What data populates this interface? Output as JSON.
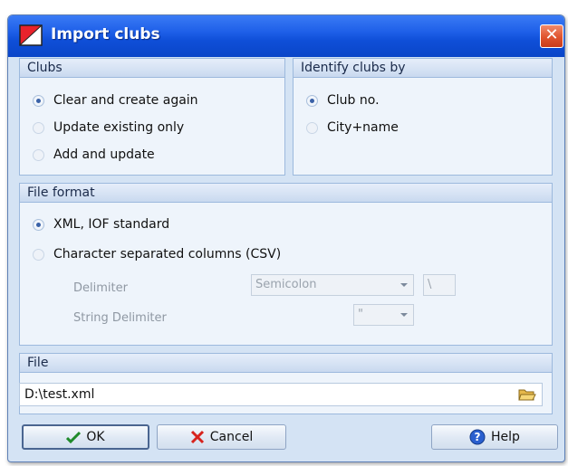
{
  "window": {
    "title": "Import clubs",
    "close_label": "✕"
  },
  "clubs_group": {
    "header": "Clubs",
    "options": [
      {
        "label": "Clear and create again",
        "checked": true
      },
      {
        "label": "Update existing only",
        "checked": false
      },
      {
        "label": "Add and update",
        "checked": false
      }
    ]
  },
  "identify_group": {
    "header": "Identify clubs by",
    "options": [
      {
        "label": "Club no.",
        "checked": true
      },
      {
        "label": "City+name",
        "checked": false
      }
    ]
  },
  "format_group": {
    "header": "File format",
    "options": [
      {
        "label": "XML, IOF standard",
        "checked": true
      },
      {
        "label": "Character separated columns (CSV)",
        "checked": false
      }
    ],
    "delimiter_label": "Delimiter",
    "delimiter_value": "Semicolon",
    "delimiter_custom": "\\",
    "string_delimiter_label": "String Delimiter",
    "string_delimiter_value": "\""
  },
  "file_group": {
    "header": "File",
    "path": "D:\\test.xml"
  },
  "buttons": {
    "ok": "OK",
    "cancel": "Cancel",
    "help": "Help"
  }
}
